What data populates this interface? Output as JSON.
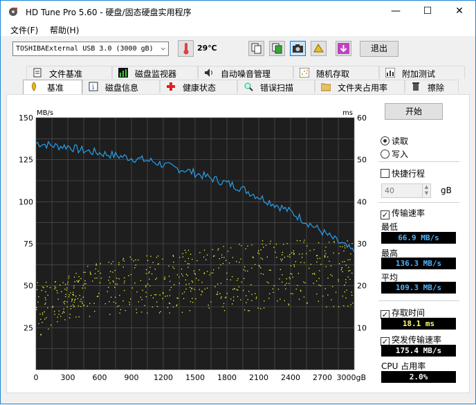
{
  "window": {
    "title": "HD Tune Pro 5.60 - 硬盘/固态硬盘实用程序",
    "minimize_glyph": "—",
    "maximize_glyph": "☐",
    "close_glyph": "✕"
  },
  "menu": {
    "file": "文件(F)",
    "help": "帮助(H)"
  },
  "toolbar": {
    "drive": "TOSHIBAExternal USB 3.0 (3000 gB)",
    "temperature": "29℃",
    "exit_label": "退出",
    "icons": [
      "copy-info-icon",
      "copy-screen-icon",
      "screenshot-icon",
      "options-icon",
      "save-icon"
    ]
  },
  "tabs": {
    "top": [
      {
        "label": "文件基准",
        "icon": "file-benchmark-icon"
      },
      {
        "label": "磁盘监视器",
        "icon": "disk-monitor-icon"
      },
      {
        "label": "自动噪音管理",
        "icon": "speaker-icon"
      },
      {
        "label": "随机存取",
        "icon": "random-access-icon"
      },
      {
        "label": "附加测试",
        "icon": "extra-tests-icon"
      }
    ],
    "bottom": [
      {
        "label": "基准",
        "icon": "benchmark-icon",
        "selected": true
      },
      {
        "label": "磁盘信息",
        "icon": "disk-info-icon"
      },
      {
        "label": "健康状态",
        "icon": "health-icon"
      },
      {
        "label": "错误扫描",
        "icon": "error-scan-icon"
      },
      {
        "label": "文件夹占用率",
        "icon": "folder-usage-icon"
      },
      {
        "label": "擦除",
        "icon": "erase-icon"
      }
    ]
  },
  "controls": {
    "start_label": "开始",
    "read_label": "读取",
    "write_label": "写入",
    "read_selected": true,
    "quick_stroke_label": "快捷行程",
    "quick_stroke_checked": false,
    "quick_stroke_value": "40",
    "quick_stroke_unit": "gB",
    "transfer_rate_label": "传输速率",
    "transfer_rate_checked": true,
    "min_label": "最低",
    "min_value": "66.9 MB/s",
    "max_label": "最高",
    "max_value": "136.3 MB/s",
    "avg_label": "平均",
    "avg_value": "109.3 MB/s",
    "access_time_label": "存取时间",
    "access_time_checked": true,
    "access_time_value": "18.1 ms",
    "burst_rate_label": "突发传输速率",
    "burst_rate_checked": true,
    "burst_rate_value": "175.4 MB/s",
    "cpu_label": "CPU 占用率",
    "cpu_value": "2.0%",
    "check_glyph": "✓"
  },
  "colors": {
    "plot_bg": "#1e1e1e",
    "grid": "#5a5a5a",
    "transfer_line": "#28a0f0",
    "access_dots": "#ffff33"
  },
  "chart_data": {
    "type": "line",
    "left_axis_label": "MB/s",
    "right_axis_label": "ms",
    "x_unit": "gB",
    "x_ticks": [
      "0",
      "300",
      "600",
      "900",
      "1200",
      "1500",
      "1800",
      "2100",
      "2400",
      "2700",
      "3000gB"
    ],
    "y_left_ticks": [
      "150",
      "125",
      "100",
      "75",
      "50",
      "25"
    ],
    "y_right_ticks": [
      "60",
      "50",
      "40",
      "30",
      "20",
      "10"
    ],
    "xlim": [
      0,
      3000
    ],
    "ylim_left": [
      0,
      150
    ],
    "ylim_right": [
      0,
      60
    ],
    "grid": true,
    "series": [
      {
        "axis": "left",
        "style": "line",
        "x": [
          0,
          100,
          200,
          300,
          400,
          500,
          600,
          700,
          800,
          900,
          1000,
          1100,
          1200,
          1300,
          1400,
          1500,
          1600,
          1700,
          1800,
          1900,
          2000,
          2100,
          2200,
          2300,
          2400,
          2500,
          2600,
          2700,
          2800,
          2900,
          3000
        ],
        "values": [
          135,
          134,
          133,
          133,
          131,
          130,
          129,
          128,
          127,
          126,
          125,
          124,
          122,
          120,
          119,
          117,
          115,
          113,
          111,
          109,
          106,
          103,
          100,
          97,
          94,
          90,
          86,
          82,
          78,
          74,
          70
        ]
      },
      {
        "axis": "right",
        "style": "scatter",
        "range_min": [
          7,
          12,
          13,
          13,
          13,
          14,
          14,
          14,
          15,
          15,
          15
        ],
        "range_max": [
          21,
          23,
          26,
          27,
          28,
          29,
          30,
          31,
          31,
          31,
          31
        ]
      }
    ]
  }
}
